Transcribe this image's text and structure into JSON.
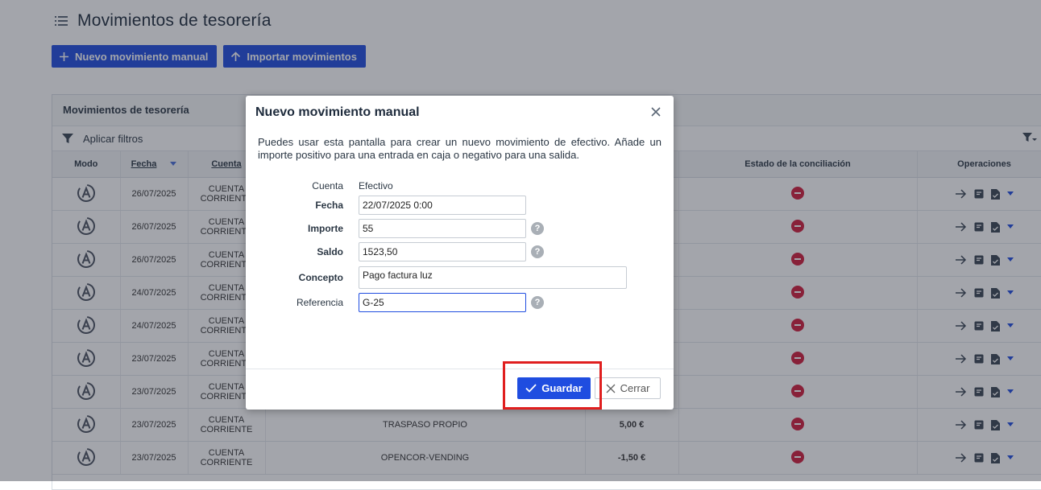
{
  "page": {
    "title": "Movimientos de tesorería",
    "new_manual_label": "Nuevo movimiento manual",
    "import_label": "Importar movimientos"
  },
  "panel": {
    "title": "Movimientos de tesorería",
    "filter_label": "Aplicar filtros",
    "columns": {
      "modo": "Modo",
      "fecha": "Fecha",
      "cuenta": "Cuenta",
      "concepto": "",
      "importe": "",
      "estado": "Estado de la conciliación",
      "operaciones": "Operaciones"
    },
    "rows": [
      {
        "fecha": "26/07/2025",
        "cuenta": "CUENTA CORRIENTE",
        "concepto": "",
        "importe": "",
        "sign": ""
      },
      {
        "fecha": "26/07/2025",
        "cuenta": "CUENTA CORRIENTE",
        "concepto": "",
        "importe": "",
        "sign": ""
      },
      {
        "fecha": "26/07/2025",
        "cuenta": "CUENTA CORRIENTE",
        "concepto": "",
        "importe": "",
        "sign": ""
      },
      {
        "fecha": "24/07/2025",
        "cuenta": "CUENTA CORRIENTE",
        "concepto": "",
        "importe": "",
        "sign": ""
      },
      {
        "fecha": "24/07/2025",
        "cuenta": "CUENTA CORRIENTE",
        "concepto": "",
        "importe": "",
        "sign": ""
      },
      {
        "fecha": "23/07/2025",
        "cuenta": "CUENTA CORRIENTE",
        "concepto": "",
        "importe": "",
        "sign": ""
      },
      {
        "fecha": "23/07/2025",
        "cuenta": "CUENTA CORRIENTE",
        "concepto": "",
        "importe": "",
        "sign": ""
      },
      {
        "fecha": "23/07/2025",
        "cuenta": "CUENTA CORRIENTE",
        "concepto": "TRASPASO PROPIO",
        "importe": "5,00 €",
        "sign": "pos"
      },
      {
        "fecha": "23/07/2025",
        "cuenta": "CUENTA CORRIENTE",
        "concepto": "OPENCOR-VENDING",
        "importe": "-1,50 €",
        "sign": "neg"
      }
    ]
  },
  "modal": {
    "title": "Nuevo movimiento manual",
    "description": "Puedes usar esta pantalla para crear un nuevo movimiento de efectivo. Añade un importe positivo para una entrada en caja o negativo para una salida.",
    "cuenta_label": "Cuenta",
    "cuenta_value": "Efectivo",
    "fecha_label": "Fecha",
    "fecha_value": "22/07/2025 0:00",
    "importe_label": "Importe",
    "importe_value": "55",
    "saldo_label": "Saldo",
    "saldo_value": "1523,50",
    "concepto_label": "Concepto",
    "concepto_value": "Pago factura luz",
    "referencia_label": "Referencia",
    "referencia_value": "G-25",
    "help_glyph": "?",
    "save_label": "Guardar",
    "close_label": "Cerrar"
  },
  "colors": {
    "primary": "#1f4de0",
    "positive": "#2f9e3a",
    "negative": "#c0392b",
    "status_red": "#d11c3c",
    "highlight": "#e01f1f"
  }
}
